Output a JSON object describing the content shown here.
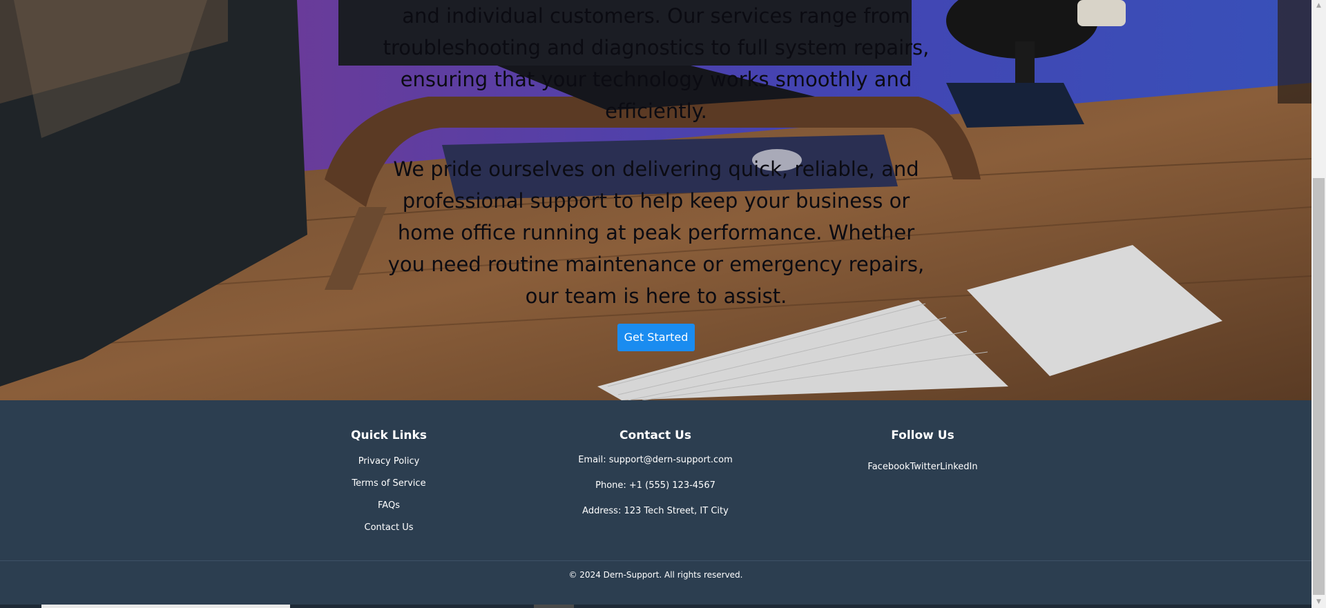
{
  "hero": {
    "paragraph_1": "and individual customers. Our services range from troubleshooting and diagnostics to full system repairs, ensuring that your technology works smoothly and efficiently.",
    "paragraph_2": "We pride ourselves on delivering quick, reliable, and professional support to help keep your business or home office running at peak performance. Whether you need routine maintenance or emergency repairs, our team is here to assist.",
    "cta_label": "Get Started",
    "cta_color": "#1a8cf0"
  },
  "footer": {
    "background_color": "#2c3e50",
    "quick_links": {
      "heading": "Quick Links",
      "items": [
        "Privacy Policy",
        "Terms of Service",
        "FAQs",
        "Contact Us"
      ]
    },
    "contact": {
      "heading": "Contact Us",
      "email": "Email: support@dern-support.com",
      "phone": "Phone: +1 (555) 123-4567",
      "address": "Address: 123 Tech Street, IT City"
    },
    "follow": {
      "heading": "Follow Us",
      "items": [
        "Facebook",
        "Twitter",
        "LinkedIn"
      ]
    },
    "copyright": "© 2024 Dern-Support. All rights reserved."
  },
  "icons": {
    "scroll_up": "scroll-up-arrow-icon",
    "scroll_down": "scroll-down-arrow-icon"
  }
}
